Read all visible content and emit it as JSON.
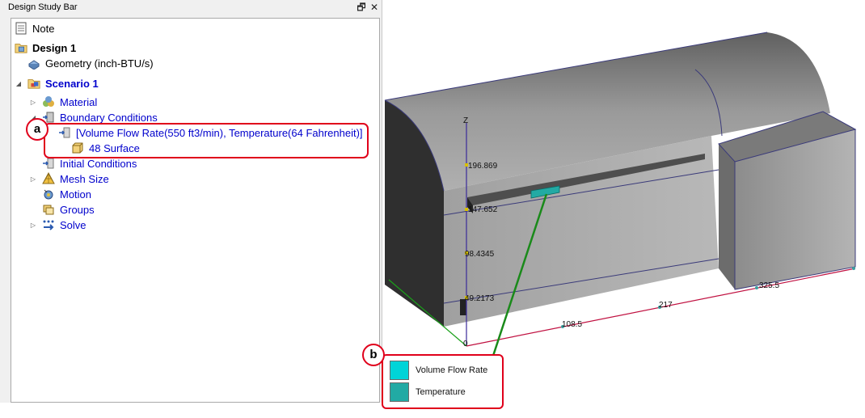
{
  "panel": {
    "title": "Design Study Bar",
    "pin_glyph": "🗗",
    "close_glyph": "✕"
  },
  "tree": {
    "note": "Note",
    "design": "Design 1",
    "geometry": "Geometry (inch-BTU/s)",
    "scenario": "Scenario 1",
    "material": "Material",
    "boundary_conditions": "Boundary Conditions",
    "bc_item": "[Volume Flow Rate(550 ft3/min), Temperature(64 Fahrenheit)]",
    "surface": "48 Surface",
    "initial_conditions": "Initial Conditions",
    "mesh_size": "Mesh Size",
    "motion": "Motion",
    "groups": "Groups",
    "solve": "Solve"
  },
  "callouts": {
    "a": "a",
    "b": "b"
  },
  "axis": {
    "z_label": "Z",
    "z_ticks": [
      "196.869",
      "147.652",
      "98.4345",
      "49.2173",
      "0"
    ],
    "x_ticks": [
      "108.5",
      "217",
      "325.5"
    ]
  },
  "legend": {
    "items": [
      {
        "label": "Volume Flow Rate",
        "color": "#00d4d8"
      },
      {
        "label": "Temperature",
        "color": "#22aaa4"
      }
    ]
  },
  "colors": {
    "annotation_red": "#e0001b",
    "tree_blue": "#0000cc",
    "leader_green": "#1a8a1a"
  }
}
